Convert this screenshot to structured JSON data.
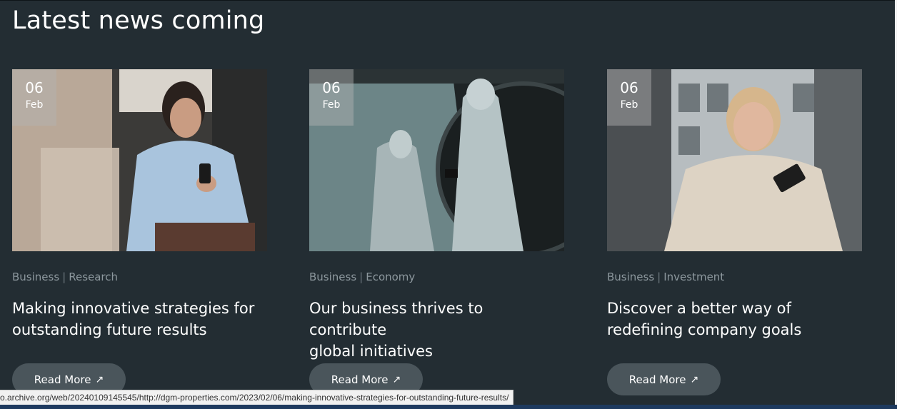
{
  "section": {
    "heading": "Latest news coming"
  },
  "cards": [
    {
      "day": "06",
      "month": "Feb",
      "category": "Business",
      "tag": "Research",
      "title_line1": "Making innovative strategies for",
      "title_line2": "outstanding future results",
      "button_label": "Read More"
    },
    {
      "day": "06",
      "month": "Feb",
      "category": "Business",
      "tag": "Economy",
      "title_line1": "Our business thrives to contribute",
      "title_line2": "global initiatives",
      "button_label": "Read More"
    },
    {
      "day": "06",
      "month": "Feb",
      "category": "Business",
      "tag": "Investment",
      "title_line1": "Discover a better way of",
      "title_line2": "redefining company goals",
      "button_label": "Read More"
    }
  ],
  "separator": "|",
  "arrow_icon": "↗",
  "status_bar": {
    "url": "o.archive.org/web/20240109145545/http://dgm-properties.com/2023/02/06/making-innovative-strategies-for-outstanding-future-results/"
  },
  "colors": {
    "background": "#232d33",
    "button": "#4a555b",
    "meta_text": "#8d989e"
  }
}
